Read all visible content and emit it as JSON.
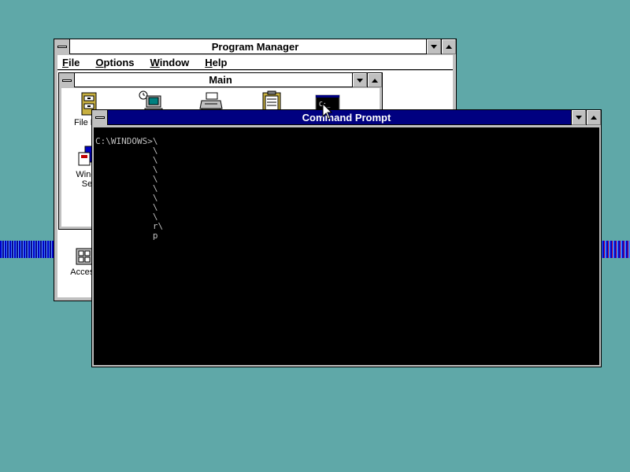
{
  "desktop": {
    "background_color": "#5fa8a8"
  },
  "program_manager": {
    "title": "Program Manager",
    "menu": [
      {
        "first": "F",
        "rest": "ile"
      },
      {
        "first": "O",
        "rest": "ptions"
      },
      {
        "first": "W",
        "rest": "indow"
      },
      {
        "first": "H",
        "rest": "elp"
      }
    ]
  },
  "main_group": {
    "title": "Main",
    "icons": [
      {
        "label": "File Ma",
        "icon": "file-manager-icon"
      },
      {
        "label": "",
        "icon": "control-panel-icon"
      },
      {
        "label": "",
        "icon": "print-manager-icon"
      },
      {
        "label": "",
        "icon": "clipboard-viewer-icon"
      },
      {
        "label": "",
        "icon": "ms-dos-prompt-icon"
      },
      {
        "label": "Windo",
        "label2": "Set",
        "icon": "windows-setup-icon"
      }
    ]
  },
  "accessories": {
    "label": "Access"
  },
  "command_prompt": {
    "title": "Command Prompt",
    "lines": [
      "C:\\WINDOWS>\\",
      "           \\",
      "           \\",
      "           \\",
      "           \\",
      "           \\",
      "           \\",
      "           \\",
      "           \\",
      "           r\\",
      "           p"
    ]
  }
}
